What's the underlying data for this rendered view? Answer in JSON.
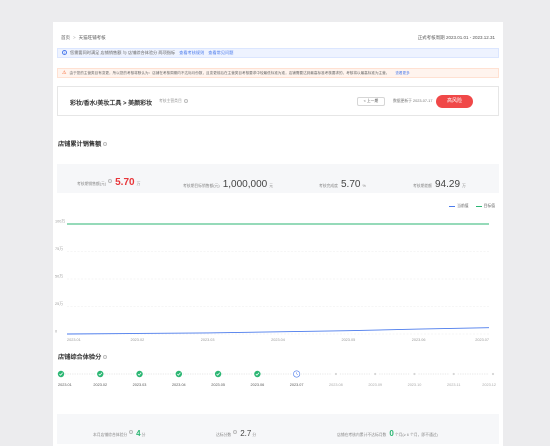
{
  "breadcrumb": {
    "home": "首页",
    "current": "天猫旺铺考核"
  },
  "period": {
    "label": "正式考核周期",
    "range": "2023.01.01 - 2023.12.31"
  },
  "info_bar": {
    "text": "您需要同时满足 店铺销售额 与 店铺综合体验分 两项指标",
    "link1": "查看考核规则",
    "link2": "查看常见问题"
  },
  "warning_bar": {
    "text": "由于您的主营类目有变更，所以您的考核将默认为：店铺在考核周期内不达标月份数，且变更前后在主营类目考核要求中较最低标准为准，店铺需要达到最高标准考核要求的，考核将以最高标准为主营。",
    "link": "查看更多"
  },
  "shop": {
    "name": "彩妆/香水/美妆工具 > 美颜彩妆",
    "tag": "考核主营类目",
    "prev_button": "< 上一期",
    "update_label": "数据更新于 2023-07-17",
    "action_button": "高风险"
  },
  "sales": {
    "section_title": "店铺累计销售额",
    "metrics": [
      {
        "label": "考核期销售额(元)",
        "value": "5.70",
        "unit": "万"
      },
      {
        "label": "考核期目标销售额(元)",
        "value": "1,000,000",
        "unit": "元"
      },
      {
        "label": "考核完成度",
        "value": "5.70",
        "unit": "%"
      },
      {
        "label": "考核期差额",
        "value": "94.29",
        "unit": "万"
      }
    ],
    "legend": [
      "当前值",
      "目标值"
    ]
  },
  "chart_data": {
    "type": "line",
    "x": [
      "2023.01",
      "2023.02",
      "2023.03",
      "2023.04",
      "2023.05",
      "2023.06",
      "2023.07"
    ],
    "y_ticks": [
      "0",
      "25万",
      "50万",
      "75万",
      "100万"
    ],
    "ylim": [
      0,
      100
    ],
    "series": [
      {
        "name": "当前值",
        "values": [
          0,
          0.5,
          1,
          2,
          3,
          4.5,
          5.7
        ],
        "color": "#4b7bec"
      },
      {
        "name": "目标值",
        "values": [
          100,
          100,
          100,
          100,
          100,
          100,
          100
        ],
        "color": "#2bb673"
      }
    ]
  },
  "experience": {
    "section_title": "店铺综合体验分",
    "months": [
      "2023.01",
      "2023.02",
      "2023.03",
      "2023.04",
      "2023.05",
      "2023.06",
      "2023.07",
      "2023.08",
      "2023.09",
      "2023.10",
      "2023.11",
      "2023.12"
    ],
    "states": [
      "done",
      "done",
      "done",
      "done",
      "done",
      "done",
      "current",
      "future",
      "future",
      "future",
      "future",
      "future"
    ],
    "summary": {
      "current_label": "本月店铺综合体验分",
      "current_value": "4",
      "current_unit": "分",
      "target_label": "达标分数",
      "target_value": "2.7",
      "target_unit": "分",
      "fail_label": "店铺在考核内累计不达标月数",
      "fail_value": "0",
      "fail_unit": "个月",
      "fail_note": "(≥ 6 个月，即不通过)"
    }
  },
  "colors": {
    "accent": "#4b7bec",
    "danger": "#f04848",
    "success": "#2bb673",
    "warning": "#f7652f"
  }
}
